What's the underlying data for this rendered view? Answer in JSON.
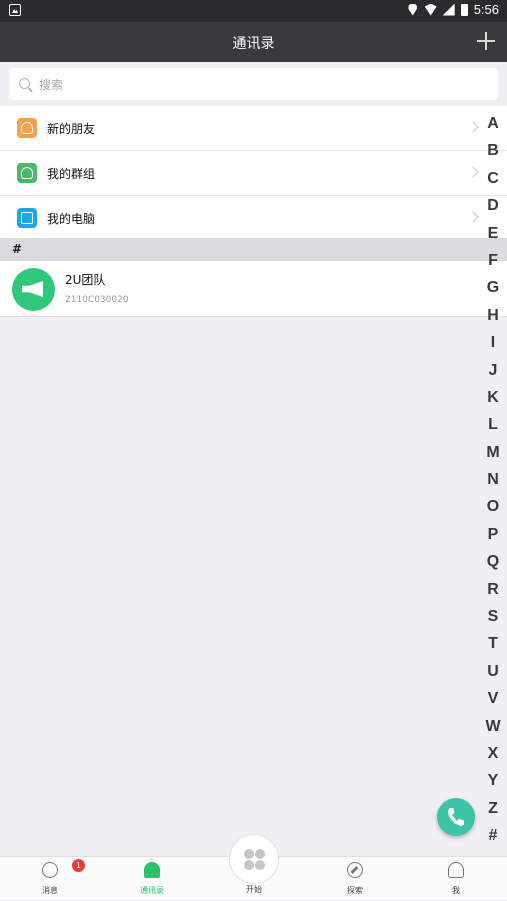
{
  "status": {
    "time": "5:56"
  },
  "header": {
    "title": "通讯录"
  },
  "search": {
    "placeholder": "搜索"
  },
  "menu": [
    {
      "label": "新的朋友",
      "color": "#f5a04c",
      "icon": "new-friend-icon"
    },
    {
      "label": "我的群组",
      "color": "#4cb86a",
      "icon": "group-icon"
    },
    {
      "label": "我的电脑",
      "color": "#1aa8e8",
      "icon": "computer-icon"
    }
  ],
  "section": {
    "label": "#"
  },
  "contacts": [
    {
      "name": "2U团队",
      "id": "2110C030020"
    }
  ],
  "index": [
    "A",
    "B",
    "C",
    "D",
    "E",
    "F",
    "G",
    "H",
    "I",
    "J",
    "K",
    "L",
    "M",
    "N",
    "O",
    "P",
    "Q",
    "R",
    "S",
    "T",
    "U",
    "V",
    "W",
    "X",
    "Y",
    "Z",
    "#"
  ],
  "tabs": [
    {
      "label": "消息",
      "badge": "1"
    },
    {
      "label": "通讯录"
    },
    {
      "label": "开始"
    },
    {
      "label": "探索"
    },
    {
      "label": "我"
    }
  ],
  "colors": {
    "accent": "#2fbf6a",
    "header": "#3a3a3d",
    "fab": "#3dc4a8",
    "badge": "#e93b3b"
  }
}
